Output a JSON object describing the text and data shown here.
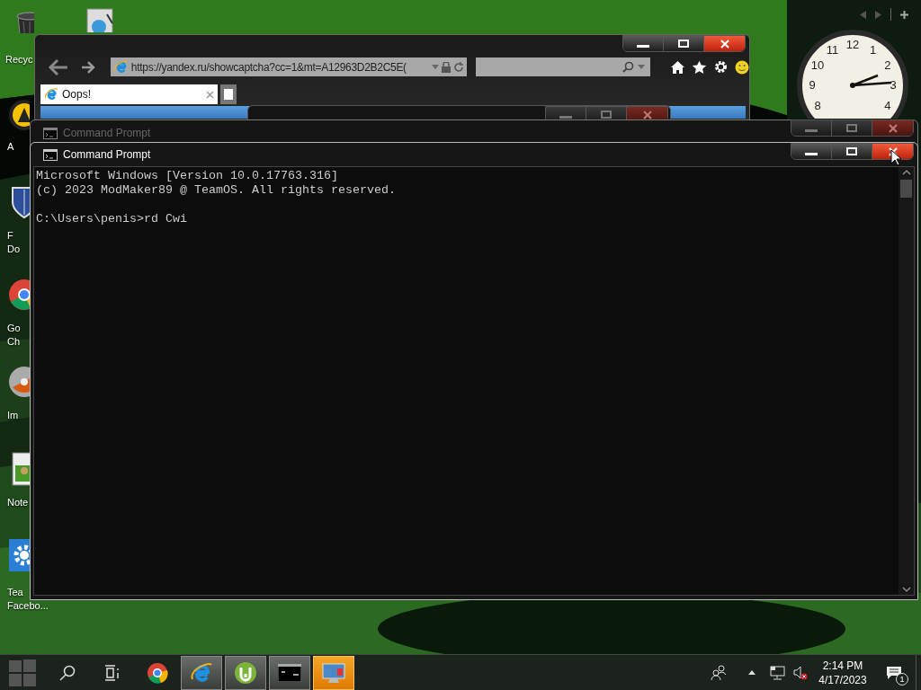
{
  "desktop_icons": [
    {
      "kind": "bin",
      "label": [
        "Recyc"
      ]
    },
    {
      "kind": "shortcut"
    },
    {
      "kind": "disc-yellow",
      "label": [
        "A"
      ]
    },
    {
      "kind": "shield",
      "label": [
        "F",
        "Do"
      ]
    },
    {
      "kind": "chrome",
      "label": [
        "Go",
        "Ch"
      ]
    },
    {
      "kind": "disc",
      "label": [
        "Im"
      ]
    },
    {
      "kind": "notepad",
      "label": [
        "Note"
      ]
    },
    {
      "kind": "gear",
      "label": [
        "Tea",
        "Facebo..."
      ]
    }
  ],
  "browser": {
    "url": "https://yandex.ru/showcaptcha?cc=1&mt=A12963D2B2C5E(",
    "tab_title": "Oops!"
  },
  "dialog": {
    "active": false
  },
  "background_console": {
    "title": "Command Prompt",
    "active": false
  },
  "console": {
    "title": "Command Prompt",
    "active": true,
    "output": [
      "Microsoft Windows [Version 10.0.17763.316]",
      "(c) 2023 ModMaker89 @ TeamOS. All rights reserved."
    ],
    "prompt": "C:\\Users\\penis>rd Cwi"
  },
  "clock": {
    "numerals": [
      "12",
      "11",
      "1",
      "10",
      "2",
      "9",
      "3",
      "8",
      "4"
    ]
  },
  "taskbar": {
    "apps": [
      {
        "kind": "chrome",
        "open": false,
        "flashing": false
      },
      {
        "kind": "ie",
        "open": true,
        "flashing": false
      },
      {
        "kind": "torrent",
        "open": true,
        "flashing": false
      },
      {
        "kind": "console",
        "open": true,
        "flashing": false
      },
      {
        "kind": "remote",
        "open": true,
        "flashing": true
      }
    ],
    "time": "2:14 PM",
    "date": "4/17/2023",
    "notifications": "1"
  }
}
